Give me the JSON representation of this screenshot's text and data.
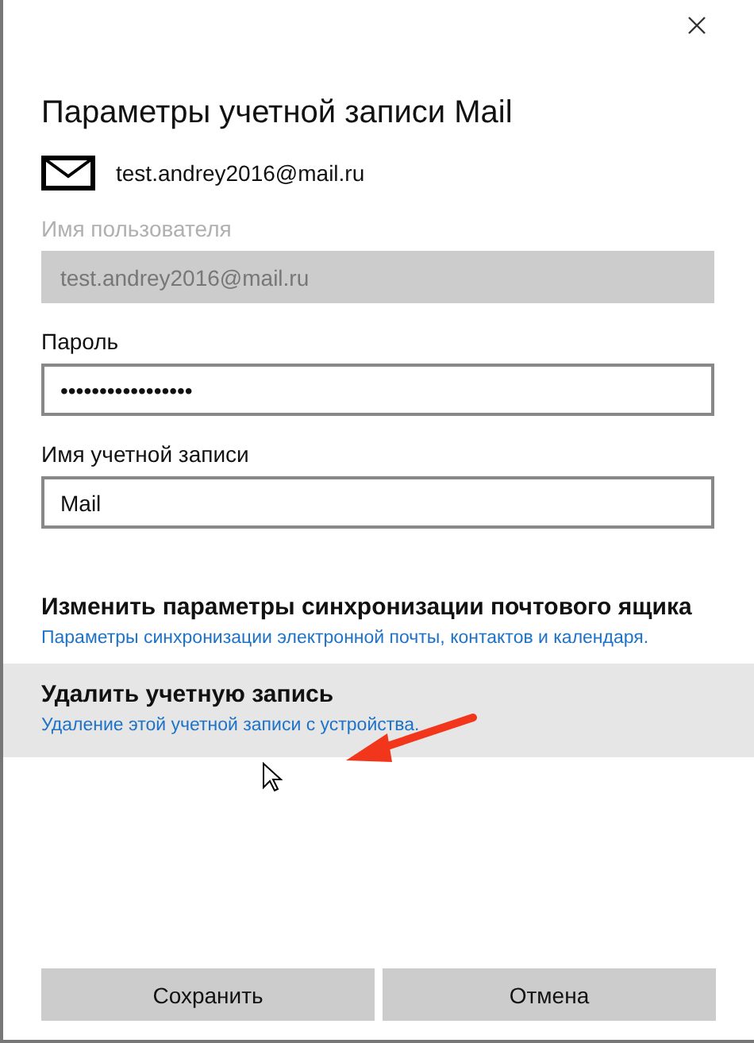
{
  "title": "Параметры учетной записи Mail",
  "account": {
    "email": "test.andrey2016@mail.ru"
  },
  "fields": [
    {
      "label": "Имя пользователя",
      "value": "test.andrey2016@mail.ru",
      "disabled": true
    },
    {
      "label": "Пароль",
      "value": "•••••••••••••••••",
      "disabled": false
    },
    {
      "label": "Имя учетной записи",
      "value": "Mail",
      "disabled": false
    }
  ],
  "actions": [
    {
      "title": "Изменить параметры синхронизации почтового ящика",
      "description": "Параметры синхронизации электронной почты, контактов и календаря.",
      "highlighted": false
    },
    {
      "title": "Удалить учетную запись",
      "description": "Удаление этой учетной записи с устройства.",
      "highlighted": true
    }
  ],
  "buttons": [
    "Сохранить",
    "Отмена"
  ]
}
